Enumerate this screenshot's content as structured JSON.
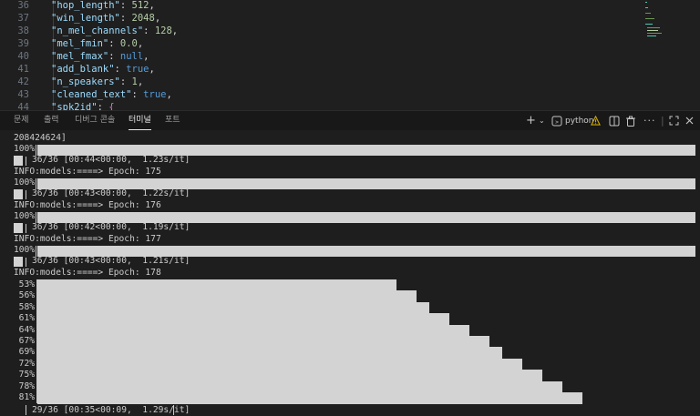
{
  "editor": {
    "lines": [
      {
        "num": "36",
        "key": "\"hop_length\"",
        "value": "512",
        "vtype": "n",
        "tail": ","
      },
      {
        "num": "37",
        "key": "\"win_length\"",
        "value": "2048",
        "vtype": "n",
        "tail": ","
      },
      {
        "num": "38",
        "key": "\"n_mel_channels\"",
        "value": "128",
        "vtype": "n",
        "tail": ","
      },
      {
        "num": "39",
        "key": "\"mel_fmin\"",
        "value": "0.0",
        "vtype": "n",
        "tail": ","
      },
      {
        "num": "40",
        "key": "\"mel_fmax\"",
        "value": "null",
        "vtype": "b",
        "tail": ","
      },
      {
        "num": "41",
        "key": "\"add_blank\"",
        "value": "true",
        "vtype": "b",
        "tail": ","
      },
      {
        "num": "42",
        "key": "\"n_speakers\"",
        "value": "1",
        "vtype": "n",
        "tail": ","
      },
      {
        "num": "43",
        "key": "\"cleaned_text\"",
        "value": "true",
        "vtype": "b",
        "tail": ","
      },
      {
        "num": "44",
        "key": "\"spk2id\"",
        "value": "{",
        "vtype": "br",
        "tail": ""
      }
    ]
  },
  "panel": {
    "tabs": [
      "문제",
      "출력",
      "디버그 콘솔",
      "터미널",
      "포트"
    ],
    "active_tab": "터미널",
    "terminal_name": "python"
  },
  "terminal": {
    "first_line": "208424624]",
    "epochs": [
      {
        "bar_label": "100%",
        "progress_text": "36/36 [00:44<00:00,  1.23s/it]",
        "info": "INFO:models:====> Epoch: 175"
      },
      {
        "bar_label": "100%",
        "progress_text": "36/36 [00:43<00:00,  1.22s/it]",
        "info": "INFO:models:====> Epoch: 176"
      },
      {
        "bar_label": "100%",
        "progress_text": "36/36 [00:42<00:00,  1.19s/it]",
        "info": "INFO:models:====> Epoch: 177"
      },
      {
        "bar_label": "100%",
        "progress_text": "36/36 [00:43<00:00,  1.21s/it]",
        "info": "INFO:models:====> Epoch: 178"
      }
    ],
    "partial_percents": [
      "53%",
      "56%",
      "58%",
      "61%",
      "64%",
      "67%",
      "69%",
      "72%",
      "75%",
      "78%",
      "81%"
    ],
    "final_progress": "29/36 [00:35<00:09,  1.29s/it]"
  },
  "colors": {
    "bar": "#d3d3d3",
    "terminal_bg": "#1e1e1e",
    "warning": "#cca700"
  }
}
